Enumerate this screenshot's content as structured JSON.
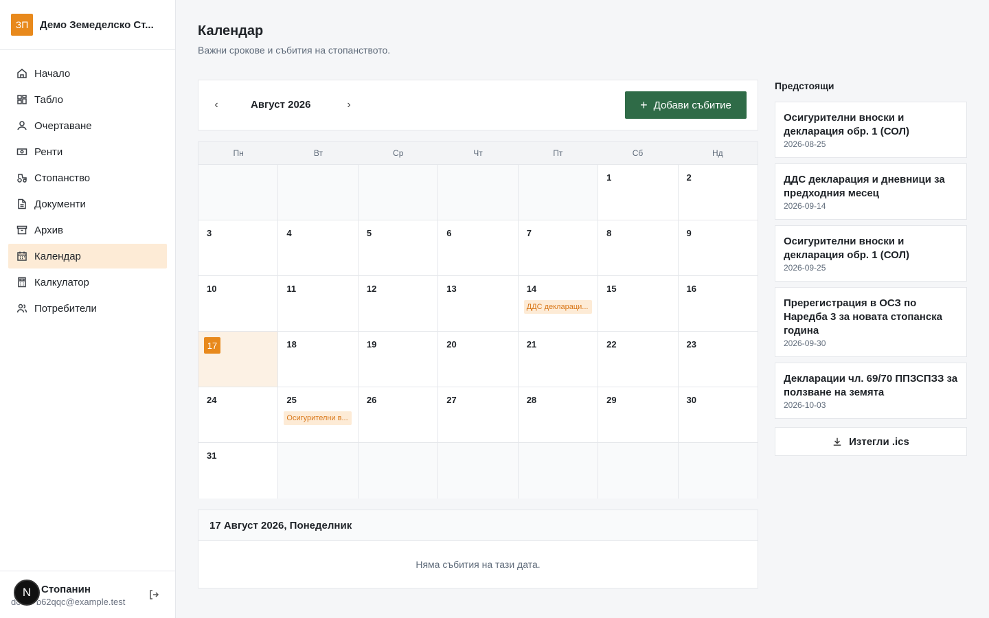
{
  "brand": {
    "logo": "ЗП",
    "name": "Демо Земеделско Ст..."
  },
  "nav": [
    {
      "label": "Начало",
      "icon": "home-icon"
    },
    {
      "label": "Табло",
      "icon": "dashboard-icon"
    },
    {
      "label": "Очертаване",
      "icon": "user-outline-icon"
    },
    {
      "label": "Ренти",
      "icon": "money-icon"
    },
    {
      "label": "Стопанство",
      "icon": "tractor-icon"
    },
    {
      "label": "Документи",
      "icon": "document-icon"
    },
    {
      "label": "Архив",
      "icon": "archive-icon"
    },
    {
      "label": "Календар",
      "icon": "calendar-icon",
      "active": true
    },
    {
      "label": "Калкулатор",
      "icon": "calculator-icon"
    },
    {
      "label": "Потребители",
      "icon": "users-icon"
    }
  ],
  "user": {
    "name": "Стопанин",
    "email": "demo-b62qqc@example.test",
    "avatar": "N"
  },
  "page": {
    "title": "Календар",
    "subtitle": "Важни срокове и събития на стопанството."
  },
  "calendar": {
    "month_label": "Август 2026",
    "prev": "‹",
    "next": "›",
    "add_button": "Добави събитие",
    "weekdays": [
      "Пн",
      "Вт",
      "Ср",
      "Чт",
      "Пт",
      "Сб",
      "Нд"
    ],
    "weeks": [
      [
        null,
        null,
        null,
        null,
        null,
        1,
        2
      ],
      [
        3,
        4,
        5,
        6,
        7,
        8,
        9
      ],
      [
        10,
        11,
        12,
        13,
        14,
        15,
        16
      ],
      [
        17,
        18,
        19,
        20,
        21,
        22,
        23
      ],
      [
        24,
        25,
        26,
        27,
        28,
        29,
        30
      ],
      [
        31,
        null,
        null,
        null,
        null,
        null,
        null
      ]
    ],
    "today": 17,
    "events": [
      {
        "day": 14,
        "label": "ДДС деклараци..."
      },
      {
        "day": 25,
        "label": "Осигурителни в..."
      }
    ]
  },
  "selected_day": {
    "title": "17 Август 2026, Понеделник",
    "empty_text": "Няма събития на тази дата."
  },
  "upcoming": {
    "title": "Предстоящи",
    "items": [
      {
        "title": "Осигурителни вноски и декларация обр. 1 (СОЛ)",
        "date": "2026-08-25"
      },
      {
        "title": "ДДС декларация и дневници за предходния месец",
        "date": "2026-09-14"
      },
      {
        "title": "Осигурителни вноски и декларация обр. 1 (СОЛ)",
        "date": "2026-09-25"
      },
      {
        "title": "Пререгистрация в ОСЗ по Наредба 3 за новата стопанска година",
        "date": "2026-09-30"
      },
      {
        "title": "Декларации чл. 69/70 ППЗСПЗЗ за ползване на земята",
        "date": "2026-10-03"
      }
    ],
    "export_label": "Изтегли .ics"
  }
}
